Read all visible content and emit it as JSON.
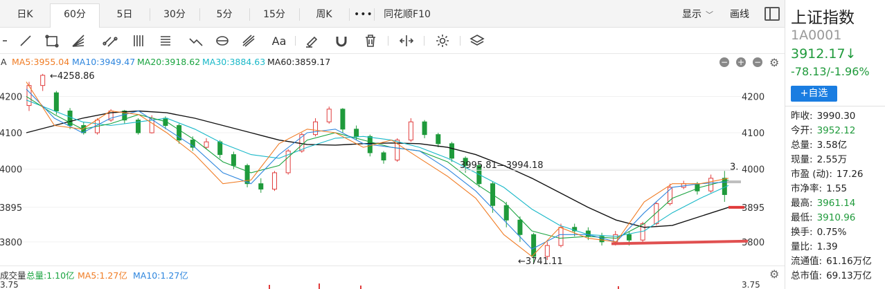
{
  "tabs": [
    {
      "label": "日K",
      "name": "tab-day-k"
    },
    {
      "label": "60分",
      "name": "tab-60min"
    },
    {
      "label": "5日",
      "name": "tab-5day"
    },
    {
      "label": "30分",
      "name": "tab-30min"
    },
    {
      "label": "5分",
      "name": "tab-5min"
    },
    {
      "label": "15分",
      "name": "tab-15min"
    },
    {
      "label": "周K",
      "name": "tab-week-k"
    },
    {
      "label": "同花顺F10",
      "name": "tab-f10"
    }
  ],
  "active_tab": "60分",
  "more_label": "•••",
  "display_label": "显示",
  "draw_label": "画线",
  "toolbar": {
    "text_tool_label": "Aa"
  },
  "legend": {
    "prefix": "A",
    "ma5": "MA5:3955.04",
    "ma10": "MA10:3949.47",
    "ma20": "MA20:3918.62",
    "ma30": "MA30:3884.63",
    "ma60": "MA60:3859.17"
  },
  "colors": {
    "up": "#e03b3b",
    "down": "#1f9a3b",
    "ma5": "#f07c24",
    "ma10": "#2e86de",
    "ma20": "#19a33f",
    "ma30": "#19b8c8",
    "ma60": "#111111",
    "accent": "#1a7de1"
  },
  "chart_data": {
    "type": "candlestick",
    "y_ticks": [
      4200,
      4100,
      4000,
      3895,
      3800
    ],
    "y_tick_labels_left": [
      "4200",
      "4100",
      "4000",
      "3895",
      "3800"
    ],
    "y_tick_labels_right": [
      "4200",
      "4100",
      "4000",
      "3895",
      "3800"
    ],
    "ylim": [
      3735,
      4275
    ],
    "annotations": {
      "high": "←4258.86",
      "low": "←3741.11",
      "range": "3995.81—3994.18",
      "right_cut": "3."
    },
    "series": [
      {
        "name": "MA60",
        "values": [
          4100,
          4120,
          4140,
          4155,
          4160,
          4155,
          4140,
          4120,
          4100,
          4080,
          4068,
          4066,
          4070,
          4072,
          4070,
          4060,
          4040,
          4010,
          3975,
          3935,
          3895,
          3860,
          3840,
          3845,
          3870,
          3895
        ]
      },
      {
        "name": "MA30",
        "values": [
          4190,
          4160,
          4130,
          4120,
          4130,
          4140,
          4110,
          4070,
          4040,
          4030,
          4060,
          4085,
          4090,
          4080,
          4060,
          4030,
          3990,
          3950,
          3890,
          3845,
          3820,
          3815,
          3830,
          3880,
          3920,
          3955
        ]
      },
      {
        "name": "MA20",
        "values": [
          4200,
          4150,
          4110,
          4125,
          4150,
          4130,
          4080,
          4020,
          3990,
          4010,
          4080,
          4100,
          4080,
          4060,
          4050,
          4020,
          3960,
          3910,
          3830,
          3810,
          3815,
          3810,
          3850,
          3920,
          3950,
          3970
        ]
      },
      {
        "name": "MA10",
        "values": [
          4220,
          4140,
          4100,
          4140,
          4160,
          4110,
          4060,
          3990,
          3960,
          4040,
          4100,
          4110,
          4070,
          4060,
          4050,
          4000,
          3940,
          3860,
          3780,
          3820,
          3820,
          3800,
          3880,
          3950,
          3960,
          3965
        ]
      },
      {
        "name": "MA5",
        "values": [
          4240,
          4120,
          4110,
          4160,
          4150,
          4100,
          4040,
          3960,
          3970,
          4070,
          4110,
          4100,
          4060,
          4080,
          4030,
          3980,
          3920,
          3820,
          3760,
          3840,
          3810,
          3800,
          3910,
          3960,
          3960,
          3975
        ]
      }
    ],
    "candles": [
      [
        4175,
        4230,
        4240,
        4160
      ],
      [
        4230,
        4258,
        4262,
        4215
      ],
      [
        4210,
        4160,
        4215,
        4150
      ],
      [
        4160,
        4120,
        4168,
        4110
      ],
      [
        4120,
        4100,
        4130,
        4095
      ],
      [
        4100,
        4135,
        4140,
        4095
      ],
      [
        4135,
        4160,
        4165,
        4130
      ],
      [
        4160,
        4135,
        4163,
        4125
      ],
      [
        4135,
        4100,
        4140,
        4095
      ],
      [
        4100,
        4140,
        4148,
        4098
      ],
      [
        4140,
        4120,
        4145,
        4110
      ],
      [
        4120,
        4080,
        4125,
        4070
      ],
      [
        4080,
        4060,
        4090,
        4050
      ],
      [
        4060,
        4075,
        4085,
        4055
      ],
      [
        4075,
        4040,
        4080,
        4030
      ],
      [
        4040,
        4010,
        4048,
        4000
      ],
      [
        4010,
        3960,
        4015,
        3950
      ],
      [
        3960,
        3945,
        3975,
        3935
      ],
      [
        3945,
        3990,
        3995,
        3940
      ],
      [
        3990,
        4050,
        4055,
        3985
      ],
      [
        4050,
        4095,
        4100,
        4045
      ],
      [
        4095,
        4130,
        4140,
        4090
      ],
      [
        4130,
        4165,
        4172,
        4125
      ],
      [
        4165,
        4110,
        4168,
        4100
      ],
      [
        4110,
        4090,
        4120,
        4080
      ],
      [
        4090,
        4045,
        4095,
        4035
      ],
      [
        4045,
        4025,
        4050,
        4015
      ],
      [
        4025,
        4080,
        4085,
        4020
      ],
      [
        4080,
        4130,
        4140,
        4075
      ],
      [
        4130,
        4095,
        4135,
        4085
      ],
      [
        4095,
        4070,
        4100,
        4060
      ],
      [
        4070,
        4030,
        4075,
        4020
      ],
      [
        4030,
        4010,
        4035,
        3990
      ],
      [
        4010,
        3960,
        4015,
        3950
      ],
      [
        3960,
        3900,
        3965,
        3880
      ],
      [
        3900,
        3860,
        3910,
        3840
      ],
      [
        3860,
        3820,
        3870,
        3800
      ],
      [
        3820,
        3760,
        3825,
        3741
      ],
      [
        3760,
        3790,
        3800,
        3750
      ],
      [
        3790,
        3840,
        3850,
        3785
      ],
      [
        3840,
        3830,
        3850,
        3815
      ],
      [
        3830,
        3815,
        3840,
        3805
      ],
      [
        3815,
        3800,
        3825,
        3790
      ],
      [
        3800,
        3820,
        3830,
        3790
      ],
      [
        3820,
        3805,
        3828,
        3790
      ],
      [
        3805,
        3850,
        3855,
        3800
      ],
      [
        3850,
        3905,
        3910,
        3845
      ],
      [
        3905,
        3950,
        3960,
        3900
      ],
      [
        3950,
        3960,
        3968,
        3945
      ],
      [
        3960,
        3940,
        3965,
        3930
      ],
      [
        3940,
        3975,
        3985,
        3935
      ],
      [
        3975,
        3930,
        3995,
        3910
      ]
    ]
  },
  "volume": {
    "label": "成交量",
    "total": "总量:1.10亿",
    "ma5": "MA5:1.27亿",
    "ma10": "MA10:1.27亿",
    "tick": "3.75"
  },
  "side": {
    "name": "上证指数",
    "code": "1A0001",
    "price": "3912.17↓",
    "change": "-78.13/-1.96%",
    "add_label": "+自选",
    "stats": [
      {
        "label": "昨收:",
        "value": "3990.30",
        "green": false
      },
      {
        "label": "今开:",
        "value": "3952.12",
        "green": true
      },
      {
        "label": "总量:",
        "value": "3.58亿",
        "green": false
      },
      {
        "label": "现量:",
        "value": "2.55万",
        "green": false
      },
      {
        "label": "市盈 (动):",
        "value": "17.26",
        "green": false
      },
      {
        "label": "市净率:",
        "value": "1.55",
        "green": false
      },
      {
        "label": "最高:",
        "value": "3961.14",
        "green": true
      },
      {
        "label": "最低:",
        "value": "3910.96",
        "green": true
      },
      {
        "label": "换手:",
        "value": "0.75%",
        "green": false
      },
      {
        "label": "量比:",
        "value": "1.39",
        "green": false
      },
      {
        "label": "流通值:",
        "value": "61.16万亿",
        "green": false
      },
      {
        "label": "总市值:",
        "value": "69.13万亿",
        "green": false
      }
    ]
  }
}
